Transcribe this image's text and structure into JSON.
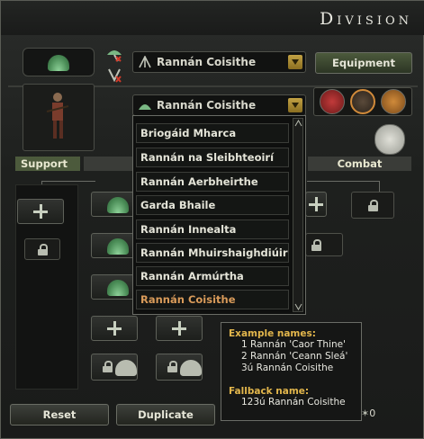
{
  "window": {
    "title": "Division"
  },
  "template": {
    "name_dropdown": "Rannán Coisithe",
    "type_dropdown": "Rannán Coisithe",
    "equipment_label": "Equipment"
  },
  "columns": {
    "support": "Support",
    "combat": "Combat"
  },
  "dropdown_options": [
    "Briogáid Mharca",
    "Rannán na Sleibhteoirí",
    "Rannán Aerbheirthe",
    "Garda Bhaile",
    "Rannán Innealta",
    "Rannán Mhuirshaighdiúir",
    "Rannán Armúrtha",
    "Rannán Coisithe"
  ],
  "tooltip": {
    "example_header": "Example names:",
    "examples": [
      "1 Rannán 'Caor Thine'",
      "2 Rannán 'Ceann Sleá'",
      "3ú Rannán Coisithe"
    ],
    "fallback_header": "Fallback name:",
    "fallback": "123ú Rannán Coisithe"
  },
  "buttons": {
    "reset": "Reset",
    "duplicate": "Duplicate"
  },
  "counter": {
    "value": "0"
  },
  "icons": [
    "helmet-icon",
    "soldier-portrait",
    "lock-icon",
    "plus-icon",
    "chevron-up-icon",
    "chevron-down-icon",
    "speech-bubble-icon",
    "star-icon"
  ],
  "colors": {
    "accent_gold": "#c2a244",
    "selected_option": "#d99b5a",
    "tooltip_header": "#e2b64c",
    "tag_green": "#4c5a3c"
  }
}
